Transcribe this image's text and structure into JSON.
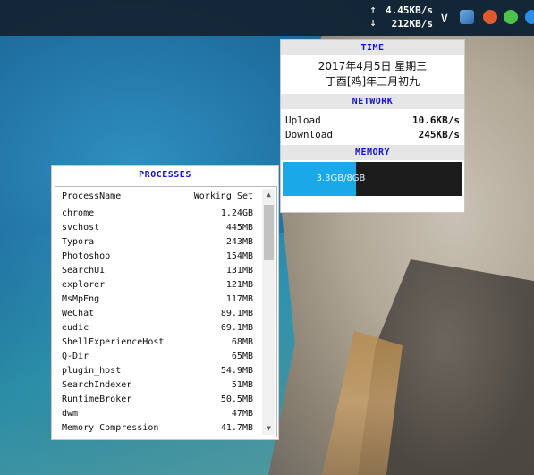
{
  "taskbar": {
    "upload_arrow": "↑",
    "download_arrow": "↓",
    "upload_speed": "4.45KB/s",
    "download_speed": "212KB/s",
    "chevron": "∨",
    "icons": [
      "app-icon",
      "shield-icon",
      "wechat-icon",
      "browser-icon"
    ]
  },
  "time": {
    "title": "TIME",
    "date_line": "2017年4月5日 星期三",
    "lunar_line": "丁酉[鸡]年三月初九"
  },
  "network": {
    "title": "NETWORK",
    "upload_label": "Upload",
    "upload_value": "10.6KB/s",
    "download_label": "Download",
    "download_value": "245KB/s"
  },
  "memory": {
    "title": "MEMORY",
    "usage_text": "3.3GB/8GB",
    "used_fraction": 0.41
  },
  "processes": {
    "title": "PROCESSES",
    "col_name": "ProcessName",
    "col_mem": "Working Set",
    "rows": [
      {
        "name": "chrome",
        "mem": "1.24GB"
      },
      {
        "name": "svchost",
        "mem": "445MB"
      },
      {
        "name": "Typora",
        "mem": "243MB"
      },
      {
        "name": "Photoshop",
        "mem": "154MB"
      },
      {
        "name": "SearchUI",
        "mem": "131MB"
      },
      {
        "name": "explorer",
        "mem": "121MB"
      },
      {
        "name": "MsMpEng",
        "mem": "117MB"
      },
      {
        "name": "WeChat",
        "mem": "89.1MB"
      },
      {
        "name": "eudic",
        "mem": "69.1MB"
      },
      {
        "name": "ShellExperienceHost",
        "mem": "68MB"
      },
      {
        "name": "Q-Dir",
        "mem": "65MB"
      },
      {
        "name": "plugin_host",
        "mem": "54.9MB"
      },
      {
        "name": "SearchIndexer",
        "mem": "51MB"
      },
      {
        "name": "RuntimeBroker",
        "mem": "50.5MB"
      },
      {
        "name": "dwm",
        "mem": "47MB"
      },
      {
        "name": "Memory Compression",
        "mem": "41.7MB"
      }
    ]
  },
  "colors": {
    "section_title": "#1515c8",
    "memory_fill": "#1aa8e8",
    "memory_bg": "#1c1c1c"
  }
}
